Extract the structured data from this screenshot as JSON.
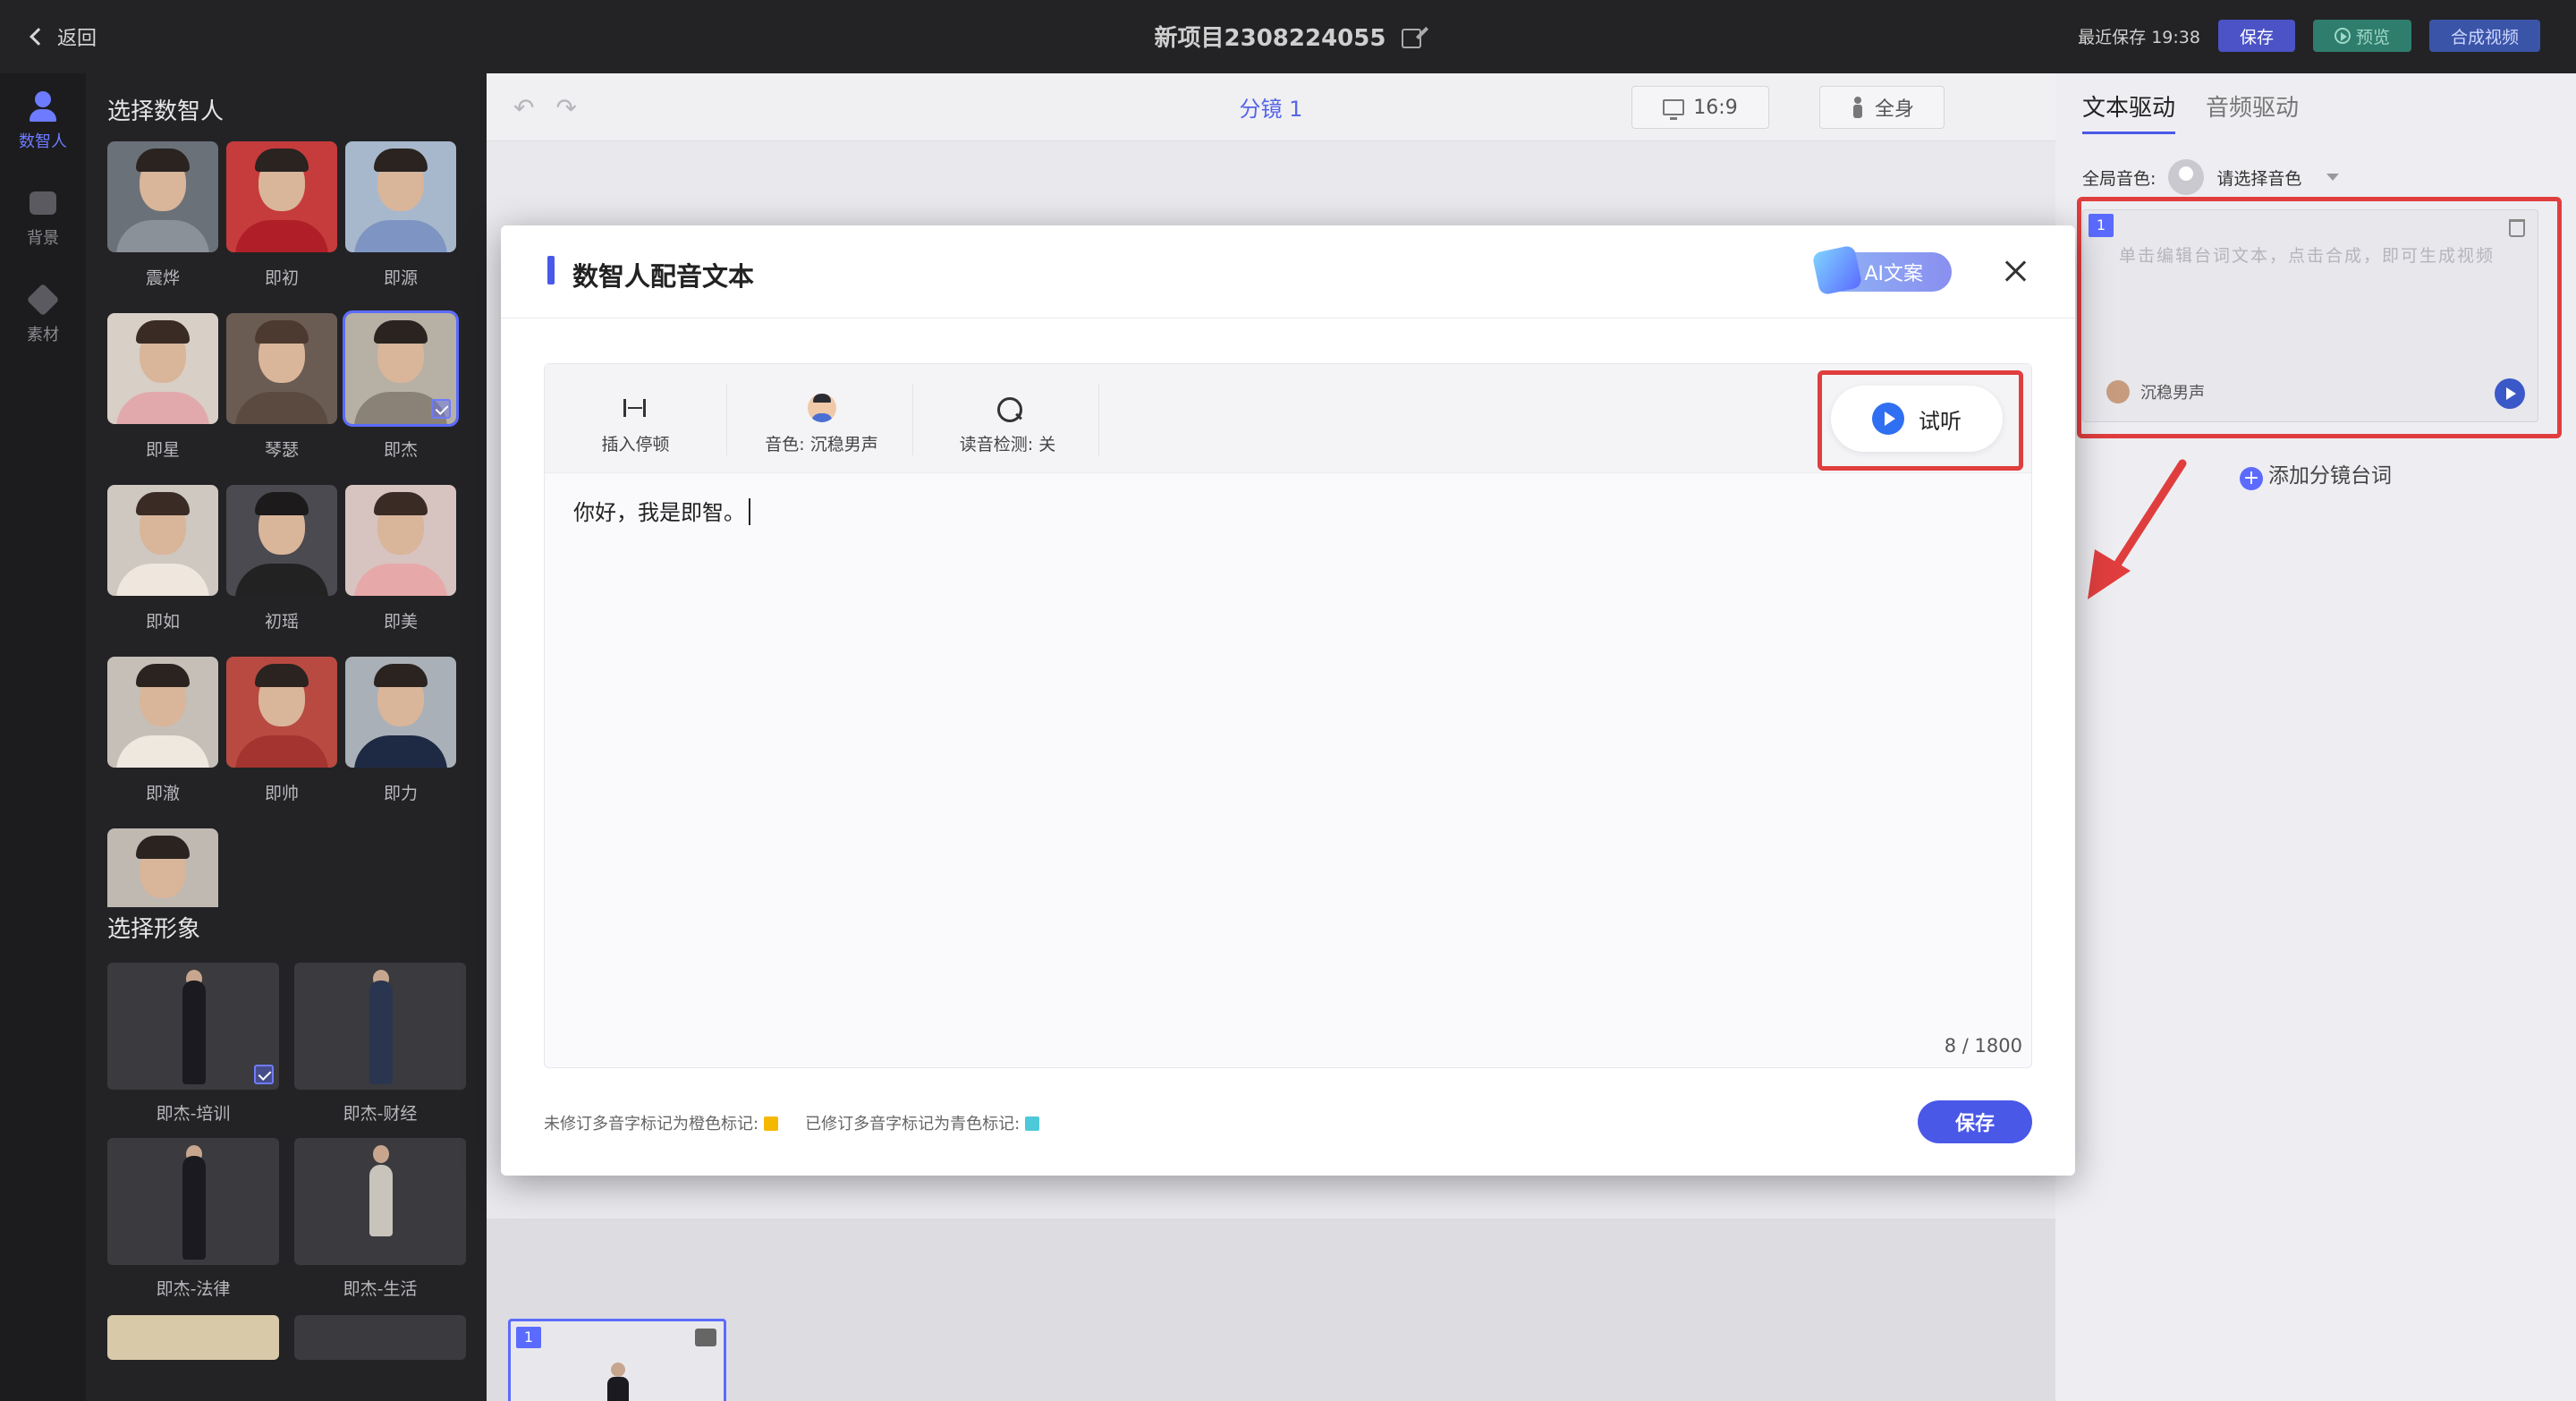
{
  "topbar": {
    "back_label": "返回",
    "project_title": "新项目2308224055",
    "last_saved": "最近保存 19:38",
    "save_label": "保存",
    "preview_label": "预览",
    "compose_label": "合成视频",
    "colors": {
      "save": "#4b53c6",
      "preview": "#2f7d6d",
      "compose": "#3a54a8"
    }
  },
  "rail": {
    "items": [
      {
        "label": "数智人",
        "icon": "person-icon",
        "active": true
      },
      {
        "label": "背景",
        "icon": "background-icon"
      },
      {
        "label": "素材",
        "icon": "material-icon"
      }
    ]
  },
  "left_panel": {
    "avatars_title": "选择数智人",
    "avatars": [
      {
        "name": "震烨"
      },
      {
        "name": "即初"
      },
      {
        "name": "即源"
      },
      {
        "name": "即星"
      },
      {
        "name": "琴瑟"
      },
      {
        "name": "即杰",
        "selected": true
      },
      {
        "name": "即如"
      },
      {
        "name": "初瑶"
      },
      {
        "name": "即美"
      },
      {
        "name": "即澈"
      },
      {
        "name": "即帅"
      },
      {
        "name": "即力"
      }
    ],
    "figures_title": "选择形象",
    "figures": [
      {
        "name": "即杰-培训",
        "selected": true
      },
      {
        "name": "即杰-财经"
      },
      {
        "name": "即杰-法律"
      },
      {
        "name": "即杰-生活"
      }
    ]
  },
  "stage": {
    "title": "分镜 1",
    "ratio_label": "16:9",
    "body_label": "全身",
    "thumb_index": "1"
  },
  "right_panel": {
    "tabs": [
      {
        "label": "文本驱动",
        "active": true
      },
      {
        "label": "音频驱动"
      }
    ],
    "global_voice_label": "全局音色:",
    "global_voice_placeholder": "请选择音色",
    "line_index": "1",
    "line_placeholder": "单击编辑台词文本，点击合成，即可生成视频",
    "line_voice": "沉稳男声",
    "add_line_label": "添加分镜台词"
  },
  "modal": {
    "title": "数智人配音文本",
    "ai_button": "AI文案",
    "tools": [
      {
        "label": "插入停顿",
        "icon": "pause-insert-icon"
      },
      {
        "label": "音色: 沉稳男声",
        "icon": "voice-avatar-icon"
      },
      {
        "label": "读音检测: 关",
        "icon": "pronunciation-check-icon"
      }
    ],
    "listen_label": "试听",
    "text_content": "你好，我是即智。",
    "counter": "8 / 1800",
    "legend_orange": "未修订多音字标记为橙色标记:",
    "legend_cyan": "已修订多音字标记为青色标记:",
    "legend_colors": {
      "orange": "#f5b800",
      "cyan": "#4dc9d9"
    },
    "save_label": "保存"
  },
  "accent_color": "#4a58e8",
  "highlight_color": "#e03e3e"
}
